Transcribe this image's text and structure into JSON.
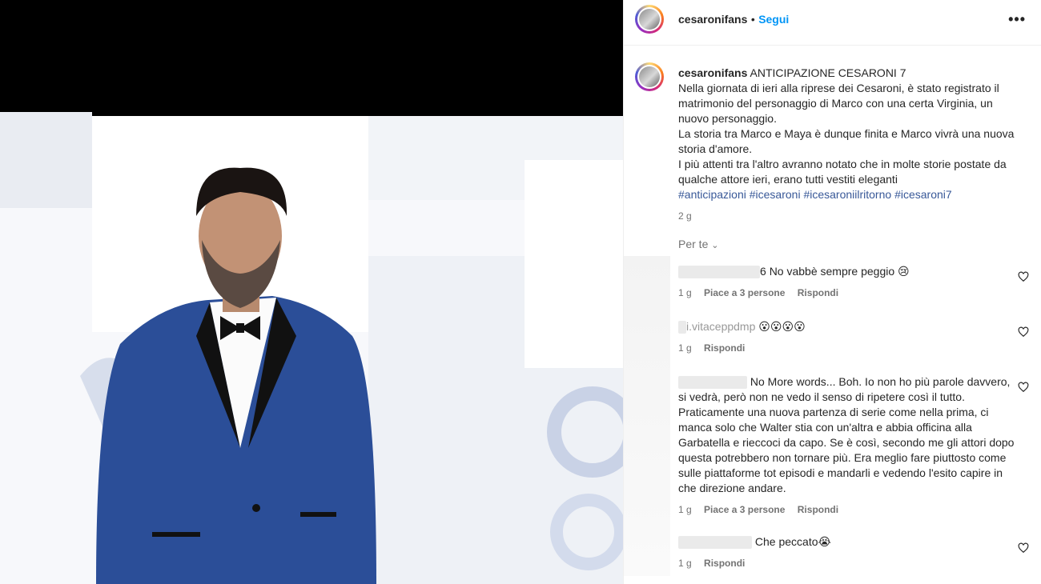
{
  "post": {
    "username": "cesaronifans",
    "separator": "•",
    "follow_label": "Segui",
    "more_icon": "•••"
  },
  "caption": {
    "username": "cesaronifans",
    "title": "ANTICIPAZIONE CESARONI 7",
    "lines": [
      "Nella giornata di ieri alla riprese dei Cesaroni, è stato registrato il",
      "matrimonio del personaggio di Marco con una certa Virginia, un",
      "nuovo personaggio.",
      "La storia tra Marco e Maya è dunque finita e Marco vivrà una nuova",
      "storia d'amore.",
      "I più attenti tra l'altro avranno notato che in molte storie postate da",
      "qualche attore ieri, erano tutti vestiti eleganti"
    ],
    "hashtags": [
      "#anticipazioni",
      "#icesaroni",
      "#icesaroniilritorno",
      "#icesaroni7"
    ],
    "age": "2 g"
  },
  "for_you": "Per te",
  "comments": [
    {
      "user": "6",
      "text": "No vabbè sempre peggio 😢",
      "age": "1 g",
      "likes": "Piace a 3 persone",
      "reply": "Rispondi"
    },
    {
      "user": "i.vitaceppdmp",
      "text": "😮😮😮😮",
      "age": "1 g",
      "likes": "",
      "reply": "Rispondi"
    },
    {
      "user": "",
      "text": "No More words... Boh. Io non ho più parole davvero, si vedrà, però non ne vedo il senso di ripetere così il tutto. Praticamente una nuova partenza di serie come nella prima, ci manca solo che Walter stia con un'altra e abbia officina alla Garbatella e rieccoci da capo. Se è così, secondo me gli attori dopo questa potrebbero non tornare più. Era meglio fare piuttosto come sulle piattaforme tot episodi e mandarli e vedendo l'esito capire in che direzione andare.",
      "age": "1 g",
      "likes": "Piace a 3 persone",
      "reply": "Rispondi"
    },
    {
      "user": "",
      "text": "Che peccato😭",
      "age": "1 g",
      "likes": "",
      "reply": "Rispondi"
    }
  ],
  "colors": {
    "accent": "#0095f6",
    "hashtag": "#385898",
    "muted": "#737373",
    "suit": "#2a4f9a"
  }
}
